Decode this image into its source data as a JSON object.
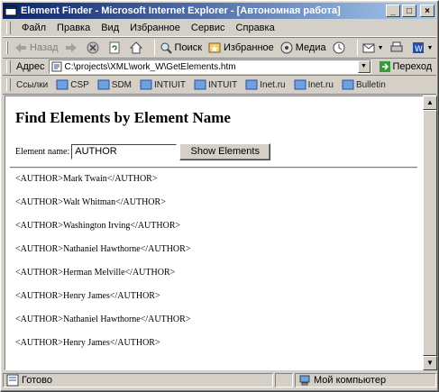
{
  "window": {
    "title": "Element Finder - Microsoft Internet Explorer - [Автономная работа]"
  },
  "title_buttons": {
    "minimize": "_",
    "maximize": "□",
    "close": "×"
  },
  "menu": [
    "Файл",
    "Правка",
    "Вид",
    "Избранное",
    "Сервис",
    "Справка"
  ],
  "toolbar": {
    "back": "Назад",
    "search": "Поиск",
    "favorites": "Избранное",
    "media": "Медиа"
  },
  "address": {
    "label": "Адрес",
    "url": "C:\\projects\\XML\\work_W\\GetElements.htm",
    "go_label": "Переход"
  },
  "links": {
    "label": "Ссылки",
    "items": [
      "CSP",
      "SDM",
      "INTIUIT",
      "INTUIT",
      "Inet.ru",
      "Inet.ru",
      "Bulletin"
    ]
  },
  "page": {
    "heading": "Find Elements by Element Name",
    "field_label": "Element name:",
    "field_value": "AUTHOR",
    "button_label": "Show Elements",
    "results": [
      "<AUTHOR>Mark Twain</AUTHOR>",
      "<AUTHOR>Walt Whitman</AUTHOR>",
      "<AUTHOR>Washington Irving</AUTHOR>",
      "<AUTHOR>Nathaniel Hawthorne</AUTHOR>",
      "<AUTHOR>Herman Melville</AUTHOR>",
      "<AUTHOR>Henry James</AUTHOR>",
      "<AUTHOR>Nathaniel Hawthorne</AUTHOR>",
      "<AUTHOR>Henry James</AUTHOR>"
    ]
  },
  "status": {
    "left": "Готово",
    "right": "Мой компьютер"
  },
  "colors": {
    "title_start": "#0a246a",
    "title_end": "#a6caf0",
    "chrome": "#d4d0c8"
  }
}
